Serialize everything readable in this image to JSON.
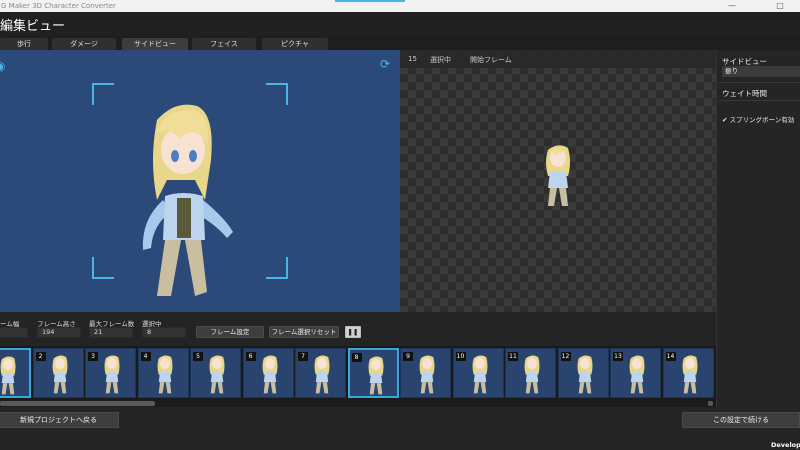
{
  "window": {
    "title": "G Maker 3D Character Converter",
    "maximize_glyph": "□"
  },
  "header": {
    "title": "編集ビュー"
  },
  "tabs": [
    {
      "label": "歩行",
      "active": false
    },
    {
      "label": "ダメージ",
      "active": false
    },
    {
      "label": "サイドビュー",
      "active": true
    },
    {
      "label": "フェイス",
      "active": false
    },
    {
      "label": "ピクチャ",
      "active": false
    }
  ],
  "viewport": {
    "icons": [
      "globe-icon",
      "refresh-icon"
    ]
  },
  "preview": {
    "frame_number": "15",
    "selecting_label": "選択中",
    "start_frame_label": "開始フレーム"
  },
  "side_panel": {
    "side_view_label": "サイドビュー",
    "motion_value": "振り",
    "wait_time_label": "ウェイト時間",
    "spring_bone_label": "スプリングボーン有効",
    "spring_bone_checked": true
  },
  "controls": {
    "frame_width_label": "ーム幅",
    "frame_height_label": "フレーム高さ",
    "frame_height_value": "194",
    "max_frames_label": "最大フレーム数",
    "max_frames_value": "21",
    "selected_label": "選択中",
    "selected_value": "8",
    "frame_settings_button": "フレーム設定",
    "reset_selection_button": "フレーム選択リセット",
    "pause_icon": "pause-icon"
  },
  "frames": {
    "numbers": [
      "",
      "2",
      "3",
      "4",
      "5",
      "6",
      "7",
      "8",
      "9",
      "10",
      "11",
      "12",
      "13",
      "14"
    ],
    "highlighted": [
      0,
      7
    ]
  },
  "footer": {
    "back_button": "新規プロジェクトへ戻る",
    "continue_button": "この設定で続ける",
    "dev_label": "Developme"
  },
  "colors": {
    "accent": "#4ab5e8",
    "viewport_bg": "#2b4a7a",
    "frame_bg": "#2a4470"
  }
}
